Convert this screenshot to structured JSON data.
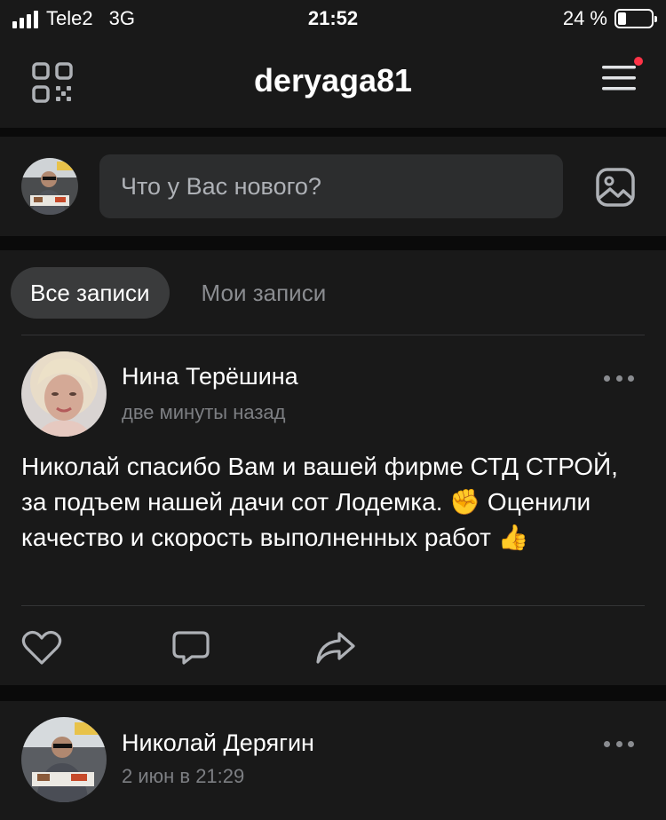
{
  "status_bar": {
    "carrier": "Tele2",
    "network": "3G",
    "time": "21:52",
    "battery_percent": "24 %",
    "battery_level": 0.24
  },
  "header": {
    "title": "deryaga81",
    "qr_icon": "qr-code-icon",
    "menu_icon": "hamburger-menu-icon",
    "notification_color": "#ff3347"
  },
  "composer": {
    "placeholder": "Что у Вас нового?",
    "photo_icon": "photo-icon"
  },
  "tabs": {
    "all": "Все записи",
    "mine": "Мои записи"
  },
  "posts": [
    {
      "author": "Нина Терёшина",
      "time": "две минуты назад",
      "text": "Николай спасибо Вам и вашей фирме СТД СТРОЙ, за подъем нашей дачи сот Лодемка. ✊ Оценили качество и скорость выполненных работ 👍"
    },
    {
      "author": "Николай Дерягин",
      "time": "2 июн в 21:29"
    }
  ],
  "colors": {
    "background": "#0a0a0a",
    "card": "#191919",
    "input": "#2c2d2e",
    "secondary_text": "#7d7f83"
  }
}
